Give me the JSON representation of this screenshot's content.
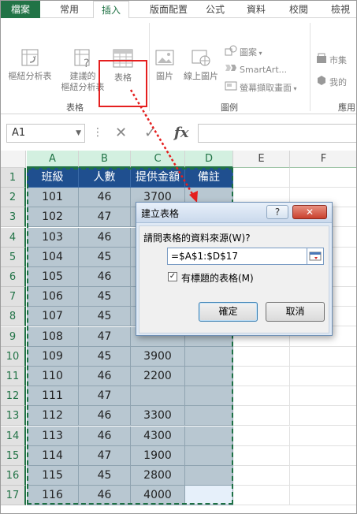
{
  "ribbon_tabs": [
    "檔案",
    "常用",
    "插入",
    "版面配置",
    "公式",
    "資料",
    "校閱",
    "檢視"
  ],
  "ribbon": {
    "pivot_table": "樞紐分析表",
    "recommended_pivot_line1": "建議的",
    "recommended_pivot_line2": "樞紐分析表",
    "table": "表格",
    "group_tables": "表格",
    "picture": "圖片",
    "online_picture": "線上圖片",
    "shapes": "圖案",
    "smartart": "SmartArt...",
    "screenshot": "螢幕擷取畫面",
    "group_illustrations": "圖例",
    "store": "市集",
    "my_apps": "我的",
    "group_apps": "應用"
  },
  "formula_bar": {
    "name_box": "A1",
    "fx": "fx",
    "value": ""
  },
  "sheet": {
    "columns": [
      "A",
      "B",
      "C",
      "D",
      "E",
      "F"
    ],
    "headers": [
      "班級",
      "人數",
      "提供金額",
      "備註"
    ],
    "rows": [
      [
        "101",
        "46",
        "3700",
        ""
      ],
      [
        "102",
        "47",
        "",
        ""
      ],
      [
        "103",
        "46",
        "",
        ""
      ],
      [
        "104",
        "45",
        "",
        ""
      ],
      [
        "105",
        "46",
        "",
        ""
      ],
      [
        "106",
        "45",
        "",
        ""
      ],
      [
        "107",
        "45",
        "",
        ""
      ],
      [
        "108",
        "47",
        "",
        ""
      ],
      [
        "109",
        "45",
        "3900",
        ""
      ],
      [
        "110",
        "46",
        "2200",
        ""
      ],
      [
        "111",
        "47",
        "",
        ""
      ],
      [
        "112",
        "46",
        "3300",
        ""
      ],
      [
        "113",
        "46",
        "4300",
        ""
      ],
      [
        "114",
        "47",
        "1900",
        ""
      ],
      [
        "115",
        "45",
        "2800",
        ""
      ],
      [
        "116",
        "46",
        "4000",
        ""
      ]
    ]
  },
  "dialog": {
    "title": "建立表格",
    "help": "?",
    "close": "✕",
    "prompt": "請問表格的資料來源(W)?",
    "range": "=$A$1:$D$17",
    "has_headers_label": "有標題的表格(M)",
    "has_headers_checked": "✓",
    "ok": "確定",
    "cancel": "取消"
  },
  "colors": {
    "excel_green": "#217346",
    "header_fill": "#1f4f8f",
    "row_fill": "#b8c7d1",
    "highlight_red": "#e51f1f"
  }
}
